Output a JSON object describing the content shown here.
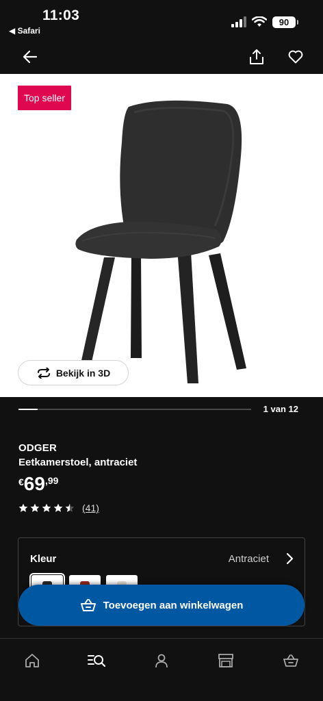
{
  "status": {
    "time": "11:03",
    "back_app": "◀ Safari",
    "battery": "90"
  },
  "product": {
    "badge": "Top seller",
    "view3d_label": "Bekijk in 3D",
    "gallery_position": "1 van 12",
    "gallery_progress": 0.083,
    "name": "ODGER",
    "description": "Eetkamerstoel, antraciet",
    "price": {
      "currency": "€",
      "integer": "69",
      "decimal": ",99"
    },
    "rating": {
      "stars": 4.5,
      "max": 5,
      "count": "(41)"
    }
  },
  "color_selector": {
    "label": "Kleur",
    "value": "Antraciet",
    "swatches": [
      {
        "name": "antraciet",
        "color": "#2b2b2b",
        "selected": true
      },
      {
        "name": "rood",
        "color": "#9b2a22",
        "selected": false
      },
      {
        "name": "wit",
        "color": "#e7e0d6",
        "selected": false
      }
    ]
  },
  "cta": {
    "label": "Toevoegen aan winkelwagen"
  },
  "tabbar": {
    "items": [
      {
        "icon": "home-icon",
        "active": false
      },
      {
        "icon": "search-list-icon",
        "active": true
      },
      {
        "icon": "profile-icon",
        "active": false
      },
      {
        "icon": "store-icon",
        "active": false
      },
      {
        "icon": "basket-icon",
        "active": false
      }
    ]
  },
  "colors": {
    "background": "#111111",
    "badge": "#e00751",
    "cta": "#0058a3",
    "image_bg": "#ffffff"
  }
}
